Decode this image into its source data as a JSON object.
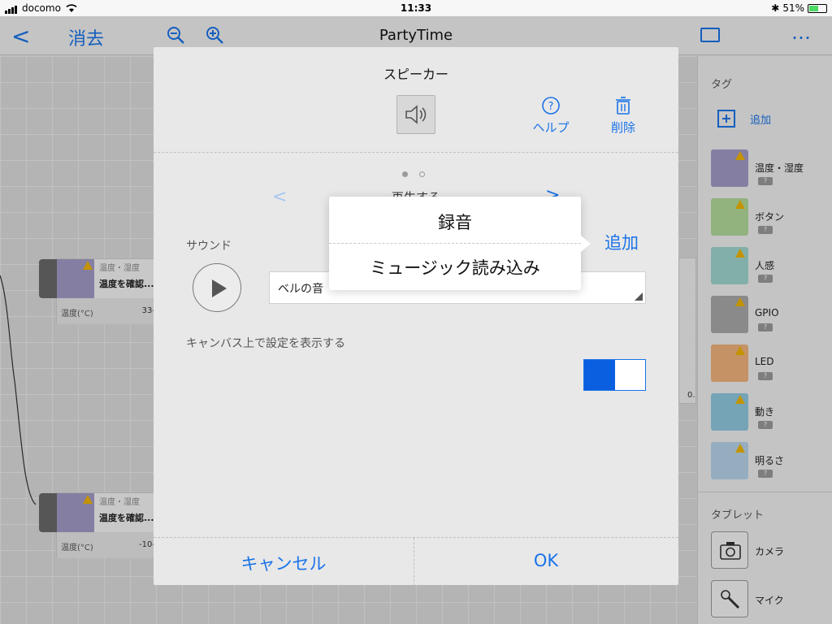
{
  "status_bar": {
    "carrier": "docomo",
    "time": "11:33",
    "battery": "51%",
    "battery_level": 0.51
  },
  "nav": {
    "back_label": "<",
    "erase_label": "消去",
    "title": "PartyTime",
    "more_label": "…"
  },
  "canvas": {
    "nodes": [
      {
        "category": "温度・湿度",
        "name": "温度を確認...",
        "unit": "温度(°C)",
        "value": "33-"
      },
      {
        "category": "温度・湿度",
        "name": "温度を確認...",
        "unit": "温度(°C)",
        "value": "-10-"
      }
    ],
    "partial_right_value": "0."
  },
  "sidebar": {
    "tags_header": "タグ",
    "add_label": "追加",
    "tags": [
      {
        "label": "温度・湿度",
        "badge": "?",
        "color": "#a29cc6"
      },
      {
        "label": "ボタン",
        "badge": "?",
        "color": "#b3d99a"
      },
      {
        "label": "人感",
        "badge": "?",
        "color": "#9fd6cf"
      },
      {
        "label": "GPIO",
        "badge": "?",
        "color": "#a9a9a9"
      },
      {
        "label": "LED",
        "badge": "?",
        "color": "#f0b37a"
      },
      {
        "label": "動き",
        "badge": "?",
        "color": "#8fc8e0"
      },
      {
        "label": "明るさ",
        "badge": "?",
        "color": "#b6d3ea"
      }
    ],
    "tablet_header": "タブレット",
    "tablet_items": [
      {
        "label": "カメラ"
      },
      {
        "label": "マイク"
      }
    ]
  },
  "modal": {
    "title": "スピーカー",
    "help_label": "ヘルプ",
    "delete_label": "削除",
    "subtitle": "再生する",
    "sound_label": "サウンド",
    "add_label": "追加",
    "selected_sound": "ベルの音",
    "show_on_canvas_label": "キャンバス上で設定を表示する",
    "toggle_on": true,
    "cancel_label": "キャンセル",
    "ok_label": "OK"
  },
  "popover": {
    "options": [
      "録音",
      "ミュージック読み込み"
    ]
  },
  "colors": {
    "accent": "#1a73e8",
    "toggle": "#0a5fe0",
    "warning": "#f0b400"
  }
}
